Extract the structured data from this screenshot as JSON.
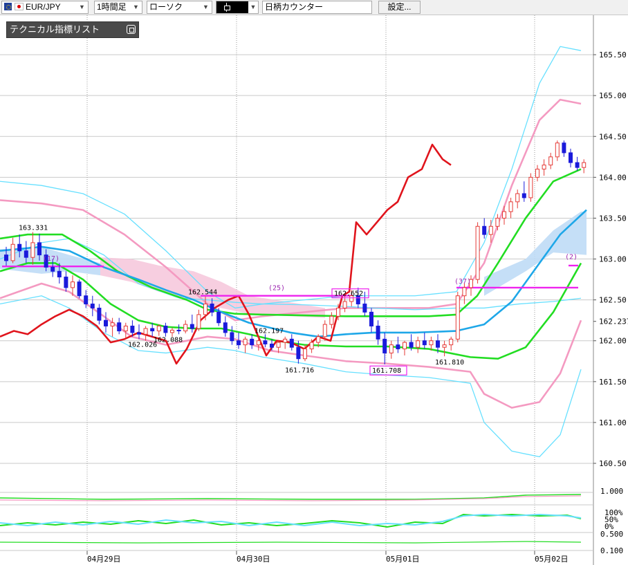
{
  "toolbar": {
    "symbol": "EUR/JPY",
    "symbol_separator": "/",
    "timeframe": "1時間足",
    "chart_type": "ローソク",
    "counter": "日柄カウンター",
    "settings_label": "設定..."
  },
  "indicator_panel": {
    "title": "テクニカル指標リスト"
  },
  "colors": {
    "up_candle": "#e53935",
    "down_candle": "#1a1adb",
    "ma_red": "#e0141c",
    "bollinger_pink": "#f49ac1",
    "bollinger_cyan": "#66e0ff",
    "ma_green": "#22dd22",
    "ma_blue": "#1ea7e8",
    "cloud_pink": "#f6c6da",
    "cloud_blue": "#bfdcf6",
    "marker_magenta": "#ee22ee"
  },
  "chart_data": {
    "type": "candlestick",
    "yticks": [
      "165.50",
      "165.00",
      "164.50",
      "164.00",
      "163.50",
      "163.00",
      "162.50",
      "162.237",
      "162.00",
      "161.50",
      "161.00",
      "160.50"
    ],
    "ytick_values": [
      165.5,
      165.0,
      164.5,
      164.0,
      163.5,
      163.0,
      162.5,
      162.237,
      162.0,
      161.5,
      161.0,
      160.5
    ],
    "ylim": [
      160.35,
      166.05
    ],
    "xticks": [
      "04月29日",
      "04月30日",
      "05月01日",
      "05月02日"
    ],
    "annotations": [
      {
        "text": "163.331",
        "value": 163.331
      },
      {
        "text": "162.544",
        "value": 162.544
      },
      {
        "text": "162.026",
        "value": 162.026
      },
      {
        "text": "162.088",
        "value": 162.088
      },
      {
        "text": "162.197",
        "value": 162.197
      },
      {
        "text": "161.716",
        "value": 161.716
      },
      {
        "text": "162.652",
        "value": 162.652
      },
      {
        "text": "161.708",
        "value": 161.708
      },
      {
        "text": "161.810",
        "value": 161.81
      }
    ],
    "count_labels": [
      "(17)",
      "(25)",
      "(37)",
      "(2)"
    ],
    "current_price": "162.237",
    "sub_axis": [
      "1.000",
      "100%",
      "50%",
      "0%",
      "0.500",
      "0.100"
    ],
    "candles": [
      [
        163.05,
        163.15,
        162.92,
        162.98
      ],
      [
        162.98,
        163.26,
        162.95,
        163.18
      ],
      [
        163.18,
        163.3,
        163.02,
        163.1
      ],
      [
        163.1,
        163.22,
        162.95,
        163.02
      ],
      [
        163.02,
        163.33,
        162.93,
        163.2
      ],
      [
        163.2,
        163.31,
        162.98,
        163.05
      ],
      [
        163.05,
        163.12,
        162.85,
        162.9
      ],
      [
        162.9,
        163.0,
        162.78,
        162.85
      ],
      [
        162.85,
        162.95,
        162.7,
        162.78
      ],
      [
        162.78,
        162.85,
        162.6,
        162.65
      ],
      [
        162.65,
        162.8,
        162.55,
        162.72
      ],
      [
        162.72,
        162.75,
        162.52,
        162.55
      ],
      [
        162.55,
        162.62,
        162.4,
        162.45
      ],
      [
        162.45,
        162.55,
        162.3,
        162.4
      ],
      [
        162.4,
        162.45,
        162.2,
        162.25
      ],
      [
        162.25,
        162.35,
        162.1,
        162.18
      ],
      [
        162.18,
        162.28,
        162.05,
        162.22
      ],
      [
        162.22,
        162.28,
        162.08,
        162.12
      ],
      [
        162.12,
        162.22,
        162.03,
        162.18
      ],
      [
        162.18,
        162.25,
        162.05,
        162.1
      ],
      [
        162.1,
        162.2,
        162.02,
        162.08
      ],
      [
        162.08,
        162.18,
        162.0,
        162.15
      ],
      [
        162.15,
        162.22,
        162.05,
        162.12
      ],
      [
        162.12,
        162.2,
        162.06,
        162.18
      ],
      [
        162.18,
        162.22,
        162.05,
        162.1
      ],
      [
        162.1,
        162.16,
        162.05,
        162.13
      ],
      [
        162.13,
        162.2,
        162.08,
        162.12
      ],
      [
        162.12,
        162.25,
        162.09,
        162.2
      ],
      [
        162.2,
        162.32,
        162.1,
        162.15
      ],
      [
        162.15,
        162.38,
        162.12,
        162.32
      ],
      [
        162.32,
        162.54,
        162.25,
        162.45
      ],
      [
        162.45,
        162.52,
        162.3,
        162.35
      ],
      [
        162.35,
        162.4,
        162.18,
        162.22
      ],
      [
        162.22,
        162.3,
        162.05,
        162.1
      ],
      [
        162.1,
        162.18,
        161.95,
        162.0
      ],
      [
        162.0,
        162.1,
        161.9,
        161.95
      ],
      [
        161.95,
        162.05,
        161.85,
        162.02
      ],
      [
        162.02,
        162.08,
        161.9,
        161.95
      ],
      [
        161.95,
        162.05,
        161.88,
        162.0
      ],
      [
        162.0,
        162.08,
        161.92,
        161.96
      ],
      [
        161.96,
        162.02,
        161.88,
        161.92
      ],
      [
        161.92,
        162.0,
        161.85,
        161.98
      ],
      [
        161.98,
        162.05,
        161.9,
        162.02
      ],
      [
        162.02,
        162.08,
        161.88,
        161.92
      ],
      [
        161.92,
        162.0,
        161.72,
        161.78
      ],
      [
        161.78,
        161.95,
        161.75,
        161.9
      ],
      [
        161.9,
        162.02,
        161.85,
        161.98
      ],
      [
        161.98,
        162.08,
        161.92,
        162.05
      ],
      [
        162.05,
        162.25,
        162.0,
        162.2
      ],
      [
        162.2,
        162.35,
        162.15,
        162.3
      ],
      [
        162.3,
        162.45,
        162.25,
        162.4
      ],
      [
        162.4,
        162.55,
        162.35,
        162.48
      ],
      [
        162.48,
        162.62,
        162.42,
        162.55
      ],
      [
        162.55,
        162.65,
        162.4,
        162.45
      ],
      [
        162.45,
        162.6,
        162.3,
        162.35
      ],
      [
        162.35,
        162.4,
        162.1,
        162.18
      ],
      [
        162.18,
        162.25,
        161.95,
        162.02
      ],
      [
        162.02,
        162.1,
        161.71,
        161.85
      ],
      [
        161.85,
        162.0,
        161.78,
        161.95
      ],
      [
        161.95,
        162.05,
        161.85,
        161.9
      ],
      [
        161.9,
        162.0,
        161.82,
        161.98
      ],
      [
        161.98,
        162.08,
        161.88,
        161.92
      ],
      [
        161.92,
        162.05,
        161.85,
        162.0
      ],
      [
        162.0,
        162.1,
        161.9,
        161.95
      ],
      [
        161.95,
        162.05,
        161.88,
        162.0
      ],
      [
        162.0,
        162.08,
        161.85,
        161.92
      ],
      [
        161.92,
        162.0,
        161.81,
        161.95
      ],
      [
        161.95,
        162.05,
        161.88,
        162.02
      ],
      [
        162.02,
        162.6,
        161.98,
        162.55
      ],
      [
        162.55,
        162.7,
        162.45,
        162.65
      ],
      [
        162.65,
        162.8,
        162.55,
        162.75
      ],
      [
        162.75,
        163.45,
        162.7,
        163.4
      ],
      [
        163.4,
        163.5,
        163.25,
        163.3
      ],
      [
        163.3,
        163.48,
        163.2,
        163.4
      ],
      [
        163.4,
        163.55,
        163.35,
        163.5
      ],
      [
        163.5,
        163.65,
        163.42,
        163.58
      ],
      [
        163.58,
        163.75,
        163.5,
        163.7
      ],
      [
        163.7,
        163.85,
        163.62,
        163.8
      ],
      [
        163.8,
        163.95,
        163.7,
        163.75
      ],
      [
        163.75,
        164.05,
        163.7,
        164.0
      ],
      [
        164.0,
        164.15,
        163.95,
        164.1
      ],
      [
        164.1,
        164.22,
        164.02,
        164.15
      ],
      [
        164.15,
        164.3,
        164.1,
        164.25
      ],
      [
        164.25,
        164.45,
        164.2,
        164.42
      ],
      [
        164.42,
        164.45,
        164.25,
        164.3
      ],
      [
        164.3,
        164.35,
        164.12,
        164.18
      ],
      [
        164.18,
        164.25,
        164.08,
        164.12
      ],
      [
        164.12,
        164.22,
        164.05,
        164.18
      ]
    ]
  }
}
